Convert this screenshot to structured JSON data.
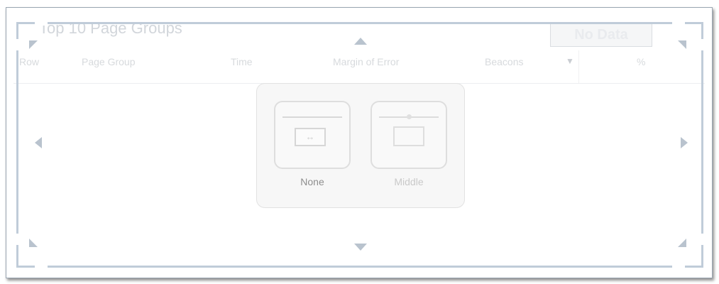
{
  "widget": {
    "title": "Top 10 Page Groups",
    "no_data_label": "No Data"
  },
  "table": {
    "columns": [
      "Row",
      "Page Group",
      "Time",
      "Margin of Error",
      "Beacons",
      "%"
    ],
    "sort_indicator": "▼"
  },
  "dock": {
    "options": [
      {
        "label": "None",
        "label_color": "#8e8e8e"
      },
      {
        "label": "Middle",
        "label_color": "#c9c9c9"
      }
    ],
    "none_icon_glyph": "↔"
  },
  "colors": {
    "selection_border": "#c0ccd9",
    "arrow": "#b9c3ce"
  }
}
